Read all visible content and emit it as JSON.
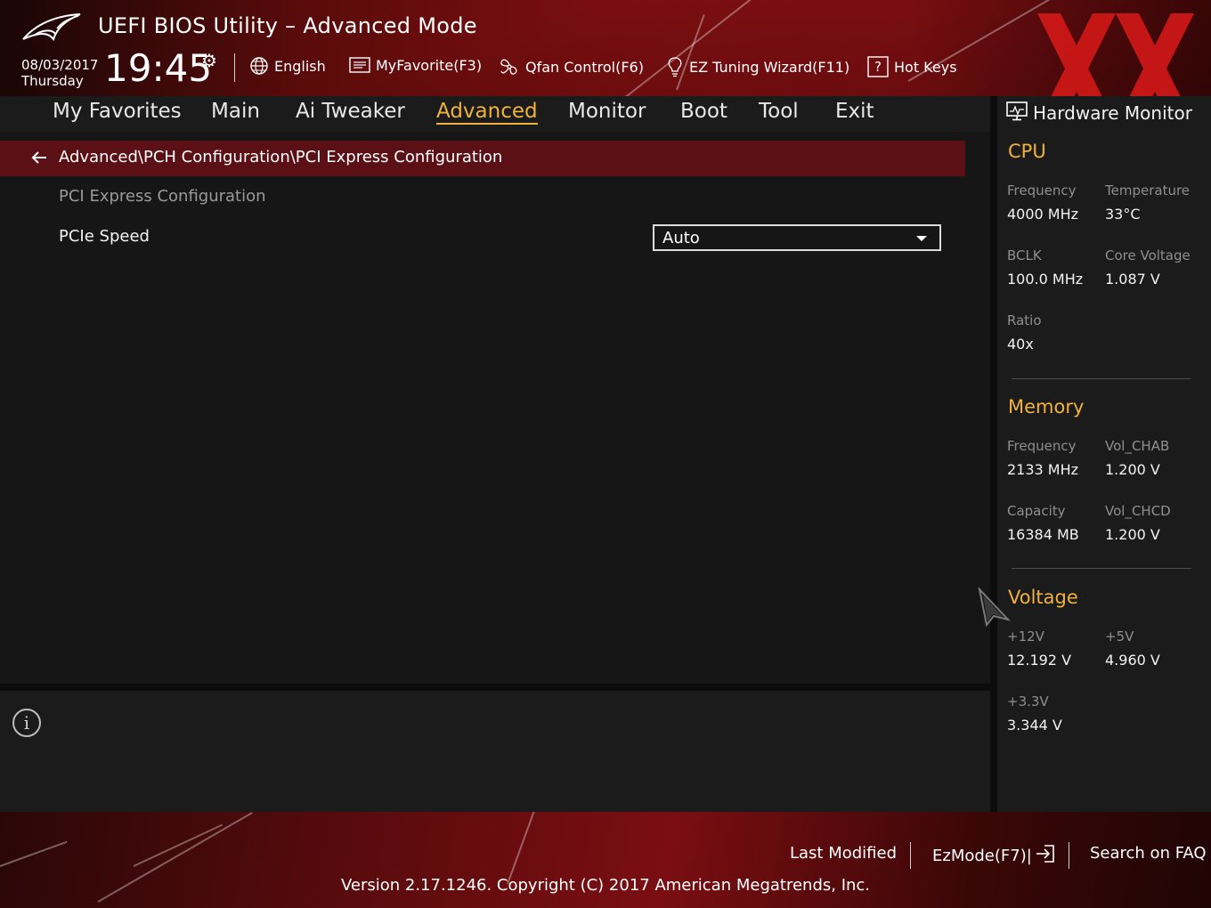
{
  "header": {
    "title": "UEFI BIOS Utility – Advanced Mode",
    "date": "08/03/2017",
    "weekday": "Thursday",
    "time": "19:45",
    "tools": [
      {
        "label": "English",
        "icon": "globe-icon"
      },
      {
        "label": "MyFavorite(F3)",
        "icon": "favorite-list-icon"
      },
      {
        "label": "Qfan Control(F6)",
        "icon": "fan-icon"
      },
      {
        "label": "EZ Tuning Wizard(F11)",
        "icon": "lightbulb-icon"
      },
      {
        "label": "Hot Keys",
        "icon": "help-box-icon"
      }
    ]
  },
  "tabs": [
    {
      "label": "My Favorites"
    },
    {
      "label": "Main"
    },
    {
      "label": "Ai Tweaker"
    },
    {
      "label": "Advanced",
      "active": true
    },
    {
      "label": "Monitor"
    },
    {
      "label": "Boot"
    },
    {
      "label": "Tool"
    },
    {
      "label": "Exit"
    }
  ],
  "main": {
    "breadcrumb": "Advanced\\PCH Configuration\\PCI Express Configuration",
    "section_label": "PCI Express Configuration",
    "settings": [
      {
        "label": "PCIe Speed",
        "value": "Auto"
      }
    ]
  },
  "hw_monitor": {
    "title": "Hardware Monitor",
    "cpu": {
      "title": "CPU",
      "frequency_label": "Frequency",
      "frequency": "4000 MHz",
      "temperature_label": "Temperature",
      "temperature": "33°C",
      "bclk_label": "BCLK",
      "bclk": "100.0 MHz",
      "core_voltage_label": "Core Voltage",
      "core_voltage": "1.087 V",
      "ratio_label": "Ratio",
      "ratio": "40x"
    },
    "memory": {
      "title": "Memory",
      "frequency_label": "Frequency",
      "frequency": "2133 MHz",
      "vol_chab_label": "Vol_CHAB",
      "vol_chab": "1.200 V",
      "capacity_label": "Capacity",
      "capacity": "16384 MB",
      "vol_chcd_label": "Vol_CHCD",
      "vol_chcd": "1.200 V"
    },
    "voltage": {
      "title": "Voltage",
      "v12_label": "+12V",
      "v12": "12.192 V",
      "v5_label": "+5V",
      "v5": "4.960 V",
      "v33_label": "+3.3V",
      "v33": "3.344 V"
    }
  },
  "footer": {
    "last_modified": "Last Modified",
    "ezmode": "EzMode(F7)|",
    "search_faq": "Search on FAQ",
    "version": "Version 2.17.1246. Copyright (C) 2017 American Megatrends, Inc."
  },
  "colors": {
    "accent": "#f0b23c",
    "breadcrumb_bg": "#5a1014",
    "header_red": "#7a0e10"
  }
}
